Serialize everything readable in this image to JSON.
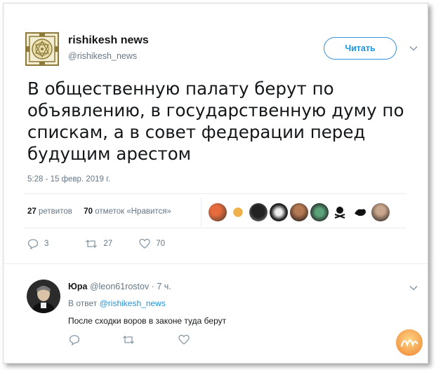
{
  "tweet": {
    "author_name": "rishikesh news",
    "author_handle": "@rishikesh_news",
    "follow_label": "Читать",
    "text": "В общественную палату берут по объявлению, в государственную думу по спискам, а в совет федерации перед будущим арестом",
    "timestamp": "5:28 - 15 февр. 2019 г.",
    "stats": {
      "retweets_count": "27",
      "retweets_label": "ретвитов",
      "likes_count": "70",
      "likes_label": "отметок «Нравится»"
    },
    "actions": {
      "replies": "3",
      "retweets": "27",
      "likes": "70"
    }
  },
  "reply": {
    "author_name": "Юра",
    "author_handle": "@leon61rostov",
    "age": "· 7 ч.",
    "reply_prefix": "В ответ",
    "reply_mention": "@rishikesh_news",
    "text": "После сходки воров в законе туда берут"
  },
  "colors": {
    "accent": "#1b95e0",
    "secondary_text": "#657786",
    "primary_text": "#14171a",
    "divider": "#e6ecf0"
  },
  "icons": [
    "chevron-down-icon",
    "reply-icon",
    "retweet-icon",
    "heart-icon",
    "mandala-logo",
    "watermark-logo"
  ]
}
